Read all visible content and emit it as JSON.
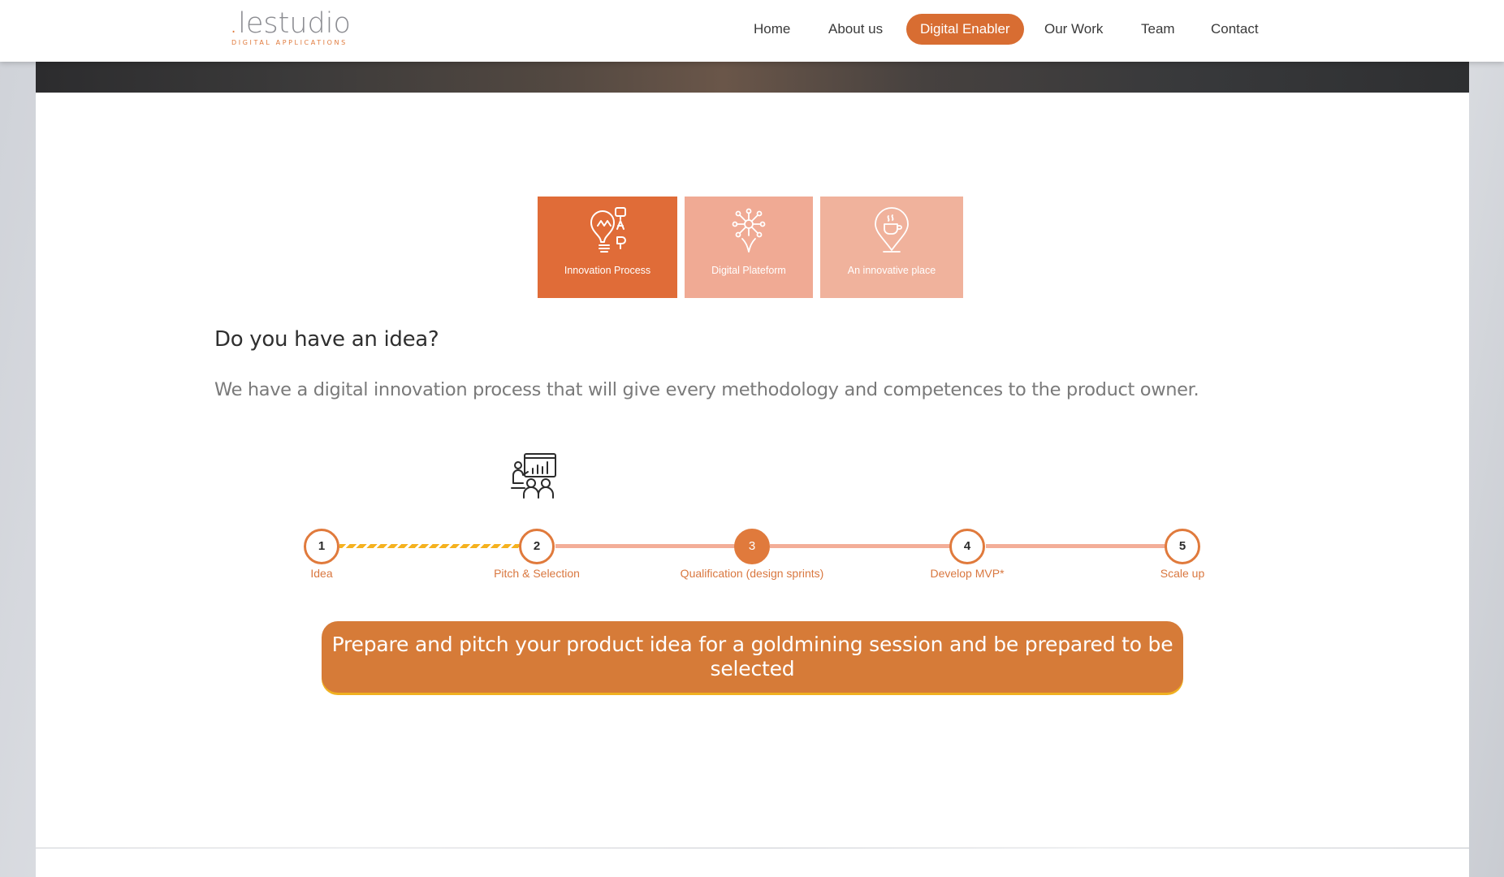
{
  "logo": {
    "dot": ".",
    "name": "lestudio",
    "tagline": "DIGITAL APPLICATIONS"
  },
  "nav": {
    "items": [
      {
        "label": "Home"
      },
      {
        "label": "About us"
      },
      {
        "label": "Digital Enabler",
        "active": true
      },
      {
        "label": "Our Work"
      },
      {
        "label": "Team"
      },
      {
        "label": "Contact"
      }
    ]
  },
  "tabs": [
    {
      "label": "Innovation Process",
      "icon": "lightbulb-icon",
      "active": true
    },
    {
      "label": "Digital Plateform",
      "icon": "network-hand-icon",
      "active": false
    },
    {
      "label": "An innovative place",
      "icon": "coffee-location-pin-icon",
      "active": false
    }
  ],
  "section": {
    "heading": "Do you have an idea?",
    "description": "We have a digital innovation process that will give every methodology and competences to the product owner."
  },
  "timeline": {
    "current_step": 3,
    "steps": [
      {
        "number": "1",
        "label": "Idea"
      },
      {
        "number": "2",
        "label": "Pitch & Selection"
      },
      {
        "number": "3",
        "label": "Qualification (design sprints)"
      },
      {
        "number": "4",
        "label": "Develop MVP*"
      },
      {
        "number": "5",
        "label": "Scale up"
      }
    ]
  },
  "cta": {
    "line1": "Prepare and pitch your product idea for a goldmining session and be prepared to be",
    "line2": "selected"
  },
  "colors": {
    "accent": "#e07a3c",
    "accent_light": "#f0aa94",
    "progress": "#f5b21f",
    "text": "#2f2f2f",
    "muted_text": "#7a7a7a"
  }
}
